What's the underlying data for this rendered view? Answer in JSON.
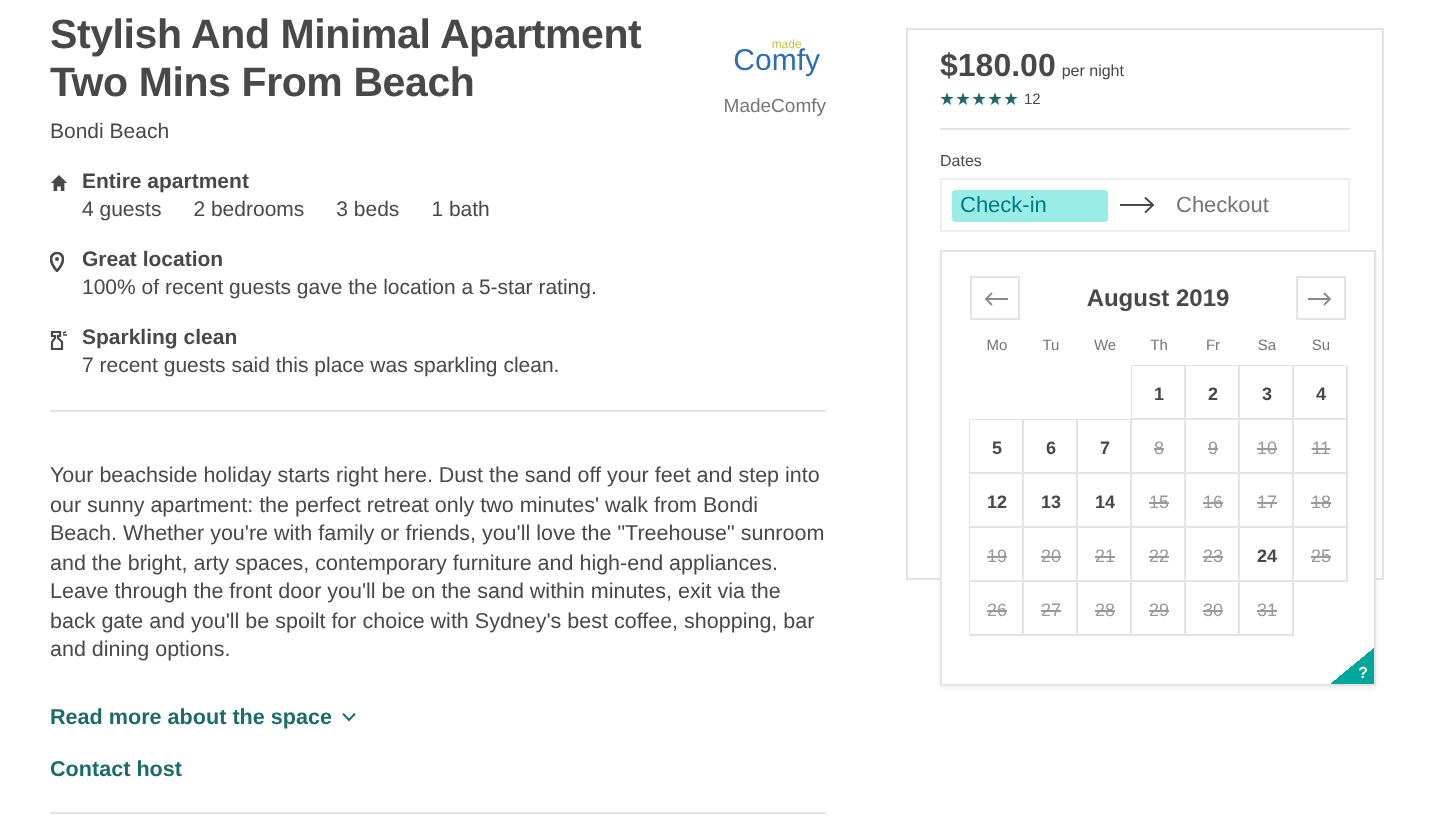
{
  "listing": {
    "title": "Stylish And Minimal Apartment Two Mins From Beach",
    "location": "Bondi Beach",
    "host": {
      "logo_small": "made",
      "logo": "Comfy",
      "name": "MadeComfy"
    },
    "highlights": [
      {
        "kind": "home",
        "title": "Entire apartment",
        "details": [
          "4 guests",
          "2 bedrooms",
          "3 beds",
          "1 bath"
        ]
      },
      {
        "kind": "location",
        "title": "Great location",
        "details": [
          "100% of recent guests gave the location a 5-star rating."
        ]
      },
      {
        "kind": "clean",
        "title": "Sparkling clean",
        "details": [
          "7 recent guests said this place was sparkling clean."
        ]
      }
    ],
    "description": "Your beachside holiday starts right here. Dust the sand off your feet and step into our sunny apartment: the perfect retreat only two minutes' walk from Bondi Beach. Whether you're with family or friends, you'll love the \"Treehouse\" sunroom and the bright, arty spaces, contemporary furniture and high-end appliances. Leave through the front door you'll be on the sand within minutes, exit via the back gate and you'll be spoilt for choice with Sydney's best coffee, shopping, bar and dining options.",
    "read_more": "Read more about the space",
    "contact": "Contact host"
  },
  "booking": {
    "price": "$180.00",
    "price_unit": "per night",
    "stars": 5,
    "review_count": "12",
    "dates_label": "Dates",
    "date_fields": [
      {
        "label": "Check-in",
        "selected": true
      },
      {
        "label": "Checkout",
        "selected": false
      }
    ]
  },
  "calendar": {
    "month": "August 2019",
    "weekdays": [
      "Mo",
      "Tu",
      "We",
      "Th",
      "Fr",
      "Sa",
      "Su"
    ],
    "weeks": [
      {
        "kind": "first",
        "days": [
          {
            "day": "1",
            "available": true
          },
          {
            "day": "2",
            "available": true
          },
          {
            "day": "3",
            "available": true
          },
          {
            "day": "4",
            "available": true
          }
        ]
      },
      {
        "kind": "week",
        "days": [
          {
            "day": "5",
            "available": true
          },
          {
            "day": "6",
            "available": true
          },
          {
            "day": "7",
            "available": true
          },
          {
            "day": "8",
            "available": false
          },
          {
            "day": "9",
            "available": false
          },
          {
            "day": "10",
            "available": false
          },
          {
            "day": "11",
            "available": false
          }
        ]
      },
      {
        "kind": "week",
        "days": [
          {
            "day": "12",
            "available": true
          },
          {
            "day": "13",
            "available": true
          },
          {
            "day": "14",
            "available": true
          },
          {
            "day": "15",
            "available": false
          },
          {
            "day": "16",
            "available": false
          },
          {
            "day": "17",
            "available": false
          },
          {
            "day": "18",
            "available": false
          }
        ]
      },
      {
        "kind": "week",
        "days": [
          {
            "day": "19",
            "available": false
          },
          {
            "day": "20",
            "available": false
          },
          {
            "day": "21",
            "available": false
          },
          {
            "day": "22",
            "available": false
          },
          {
            "day": "23",
            "available": false
          },
          {
            "day": "24",
            "available": true
          },
          {
            "day": "25",
            "available": false
          }
        ]
      },
      {
        "kind": "week",
        "days": [
          {
            "day": "26",
            "available": false
          },
          {
            "day": "27",
            "available": false
          },
          {
            "day": "28",
            "available": false
          },
          {
            "day": "29",
            "available": false
          },
          {
            "day": "30",
            "available": false
          },
          {
            "day": "31",
            "available": false
          }
        ]
      }
    ],
    "help": "?"
  }
}
